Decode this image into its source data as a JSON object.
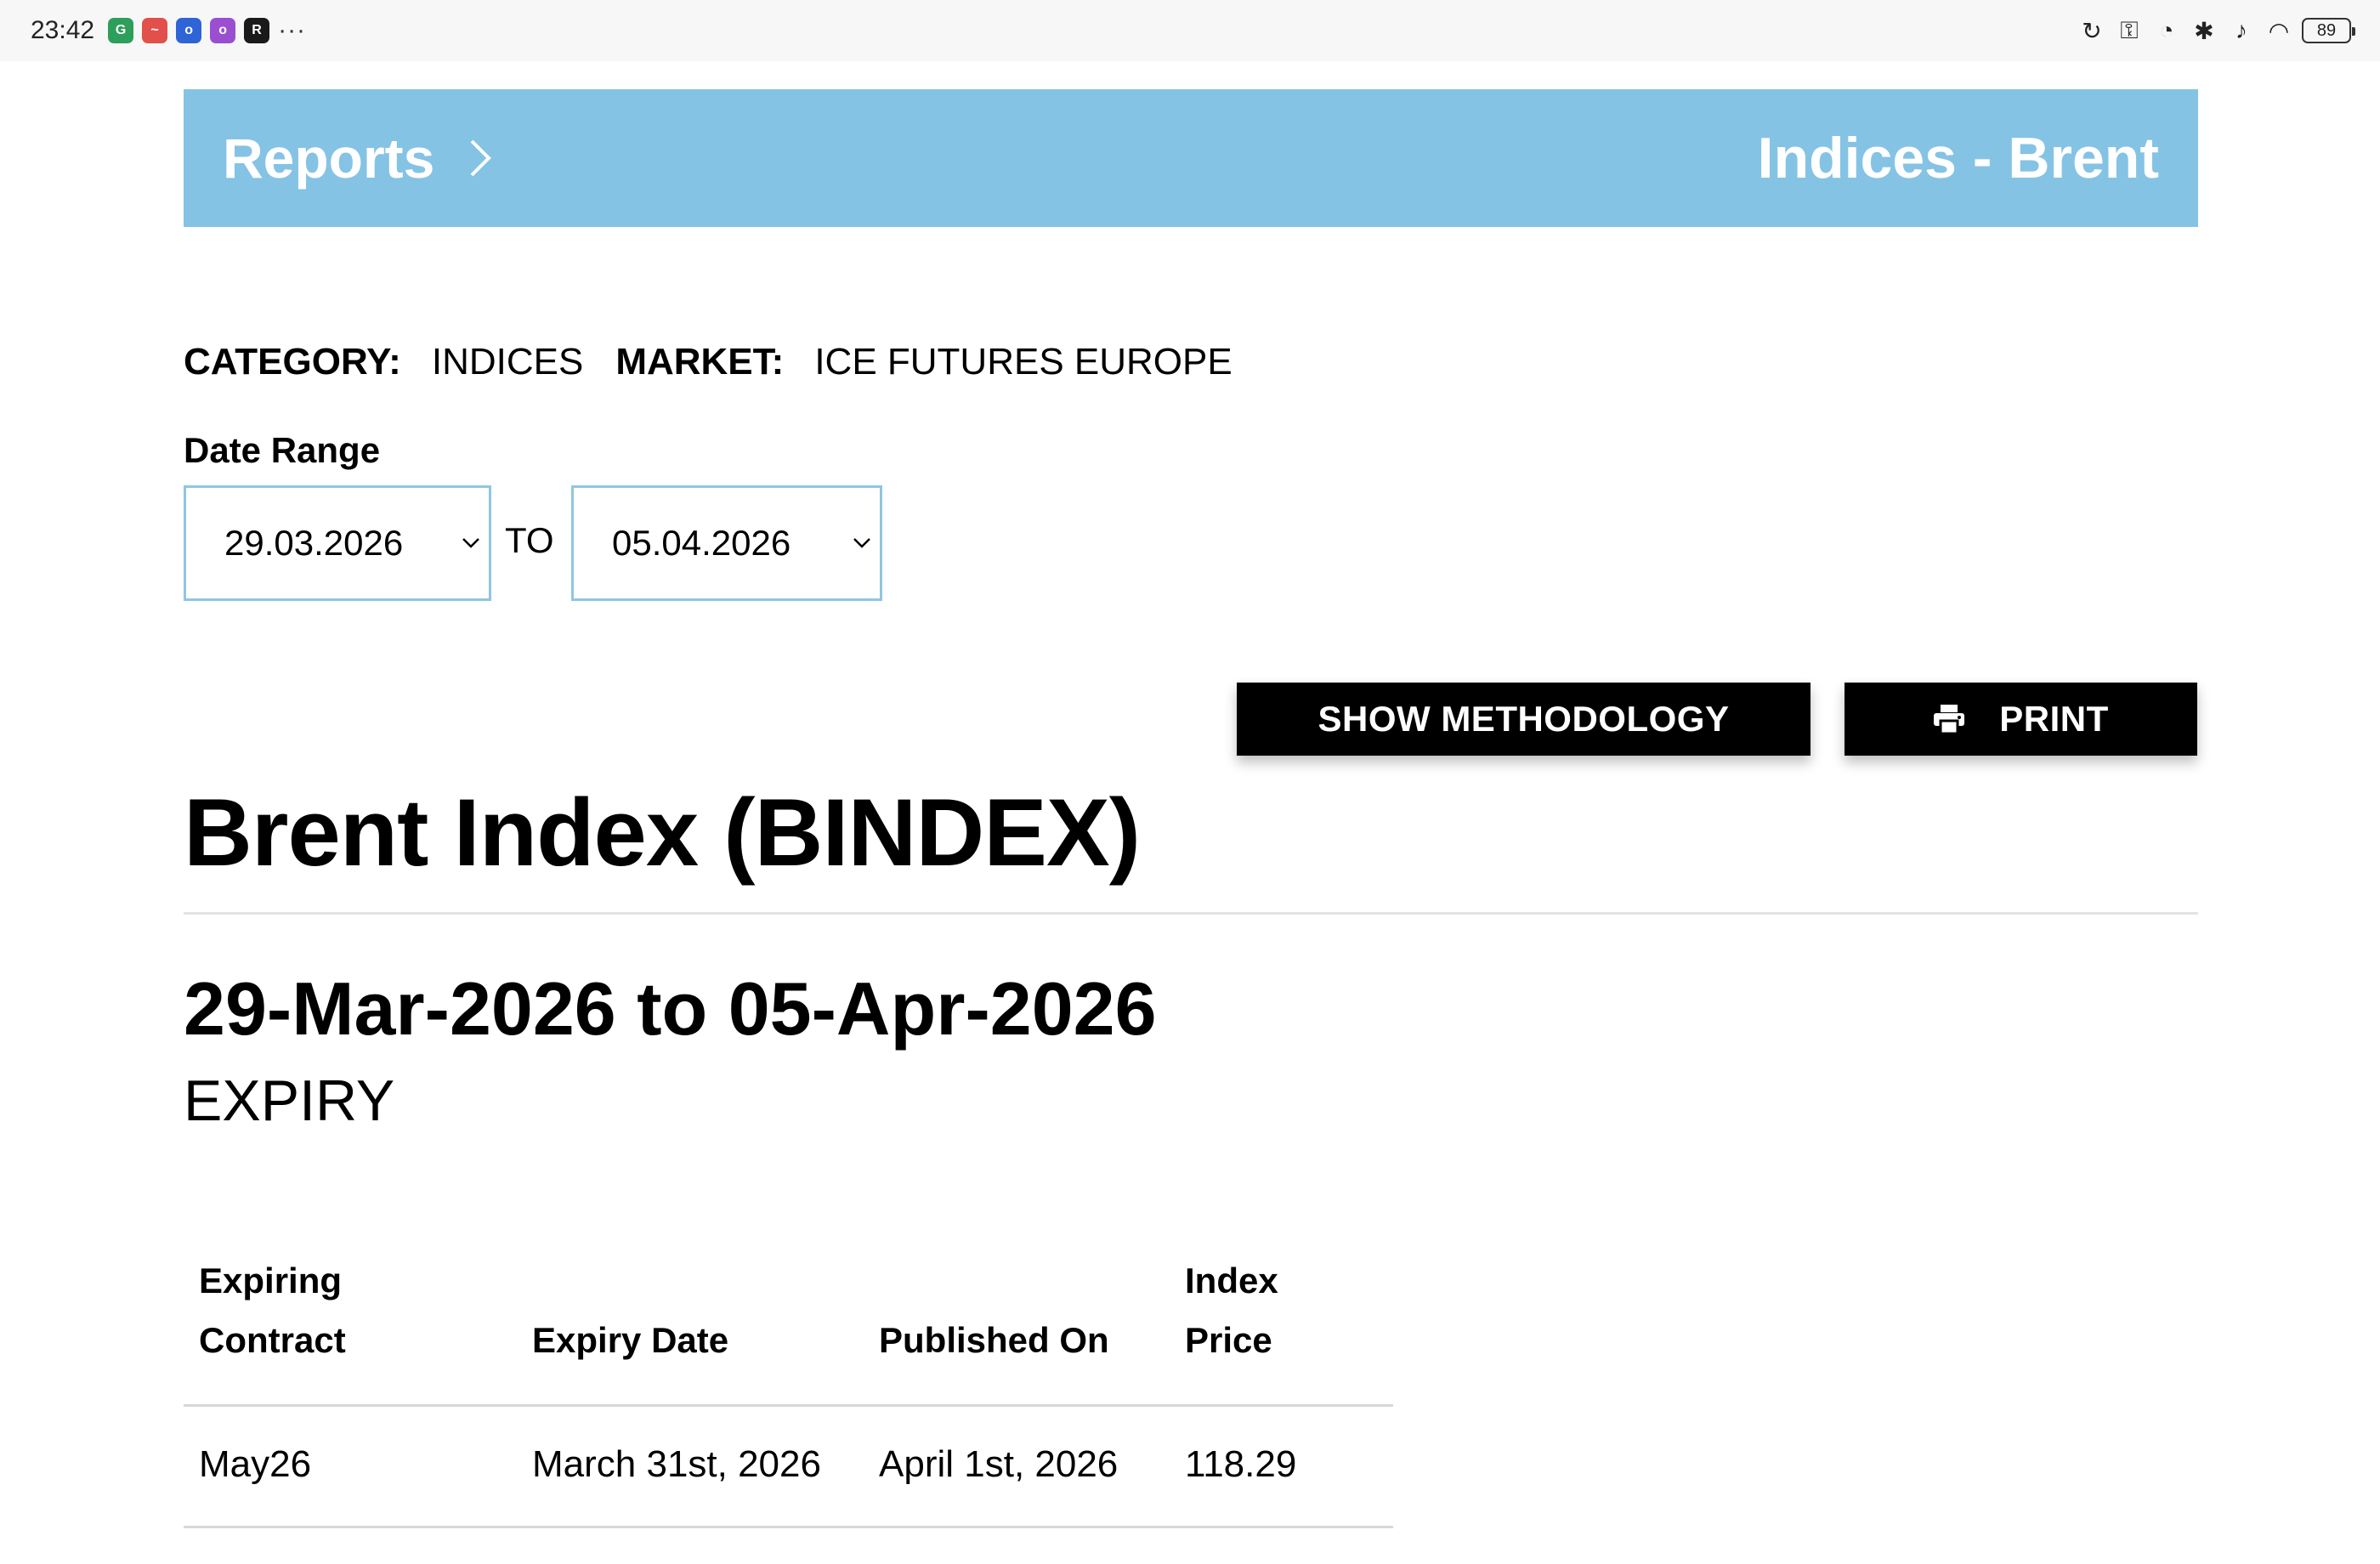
{
  "status_bar": {
    "time": "23:42",
    "battery": "89",
    "notification_icons": [
      {
        "icon": "app-icon-green",
        "color": "#2e9e5b",
        "glyph": "G"
      },
      {
        "icon": "app-icon-red",
        "color": "#e2504c",
        "glyph": "~"
      },
      {
        "icon": "app-icon-blue",
        "color": "#2f64d6",
        "glyph": "o"
      },
      {
        "icon": "app-icon-purple",
        "color": "#9a4fd0",
        "glyph": "o"
      },
      {
        "icon": "app-icon-dark",
        "color": "#1a1a1a",
        "glyph": "R"
      }
    ],
    "more": "···"
  },
  "header": {
    "breadcrumb_root": "Reports",
    "title": "Indices - Brent",
    "background_color": "#85c3e5"
  },
  "meta": {
    "category_label": "CATEGORY:",
    "category_value": "INDICES",
    "market_label": "MARKET:",
    "market_value": "ICE FUTURES EUROPE"
  },
  "date_range": {
    "label": "Date Range",
    "from": "29.03.2026",
    "separator": "TO",
    "to": "05.04.2026"
  },
  "actions": {
    "methodology_label": "SHOW METHODOLOGY",
    "print_label": "PRINT"
  },
  "report": {
    "title": "Brent Index (BINDEX)",
    "range_heading": "29-Mar-2026 to 05-Apr-2026",
    "section_label": "EXPIRY"
  },
  "table": {
    "headers": [
      "Expiring Contract",
      "Expiry Date",
      "Published On",
      "Index Price"
    ],
    "rows": [
      [
        "May26",
        "March 31st, 2026",
        "April 1st, 2026",
        "118.29"
      ]
    ]
  }
}
